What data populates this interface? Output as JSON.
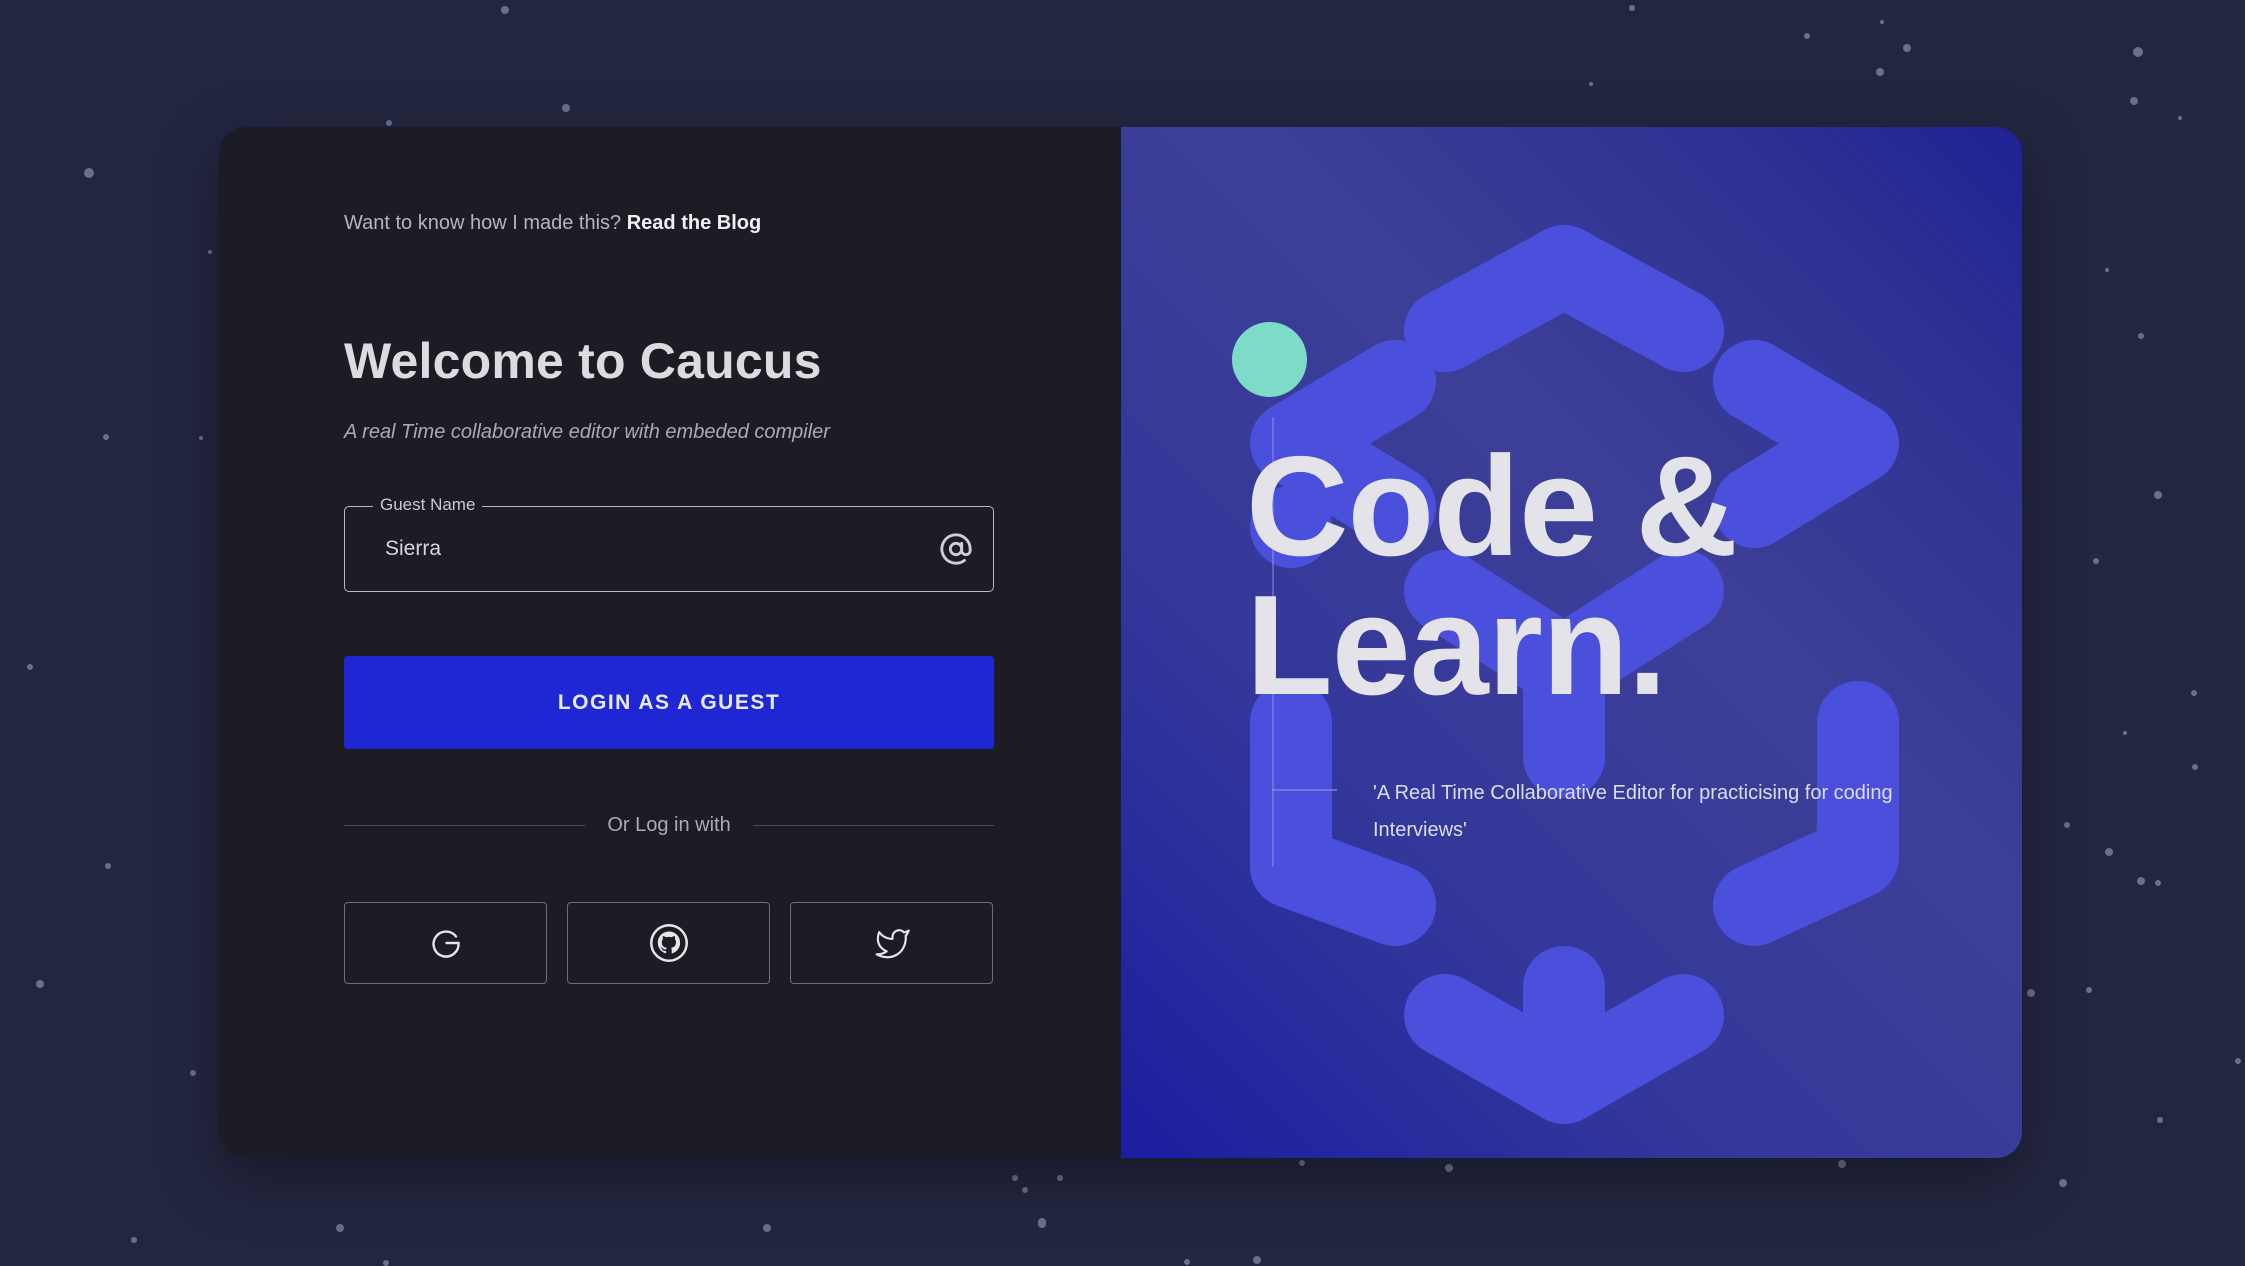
{
  "blog_prompt": {
    "text": "Want to know how I made this?",
    "link_label": "Read the Blog"
  },
  "login": {
    "title": "Welcome to Caucus",
    "subtitle": "A real Time collaborative editor with embeded compiler",
    "guest_field": {
      "label": "Guest Name",
      "value": "Sierra",
      "icon": "at-sign-icon"
    },
    "login_button_label": "LOGIN AS A GUEST",
    "divider_text": "Or Log in with",
    "social_buttons": [
      {
        "name": "Google",
        "icon": "google-icon"
      },
      {
        "name": "GitHub",
        "icon": "github-icon"
      },
      {
        "name": "Twitter",
        "icon": "twitter-icon"
      }
    ]
  },
  "hero": {
    "line1": "Code &",
    "line2": "Learn.",
    "quote": "'A Real Time Collaborative Editor for practicising for coding Interviews'"
  },
  "colors": {
    "page_background": "#232640",
    "panel_background": "#1c1d24",
    "primary_button": "#1f27d4",
    "accent_mint": "#7ddcc8",
    "hero_shape": "#4a4fdc"
  }
}
